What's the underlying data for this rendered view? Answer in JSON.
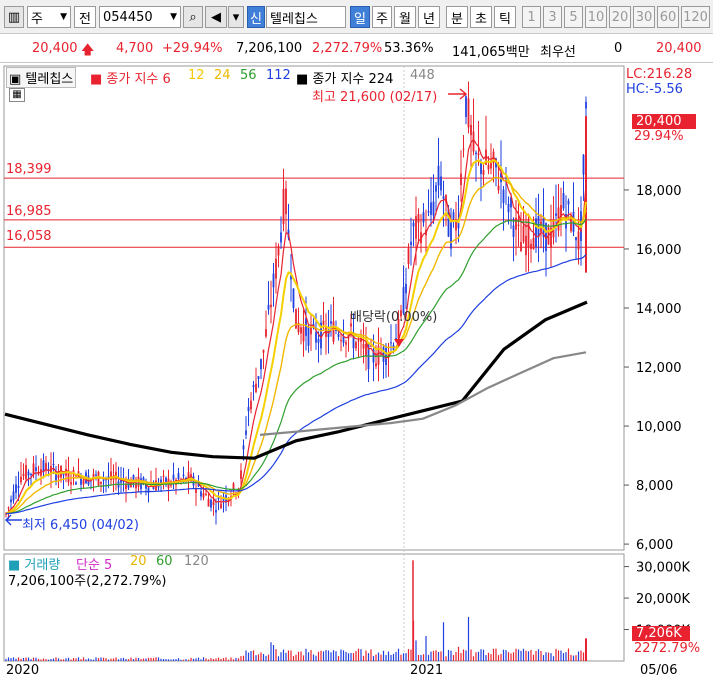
{
  "toolbar": {
    "market": "주",
    "type": "전",
    "code": "054450",
    "name_tag": "신",
    "name": "텔레칩스",
    "periods": [
      "일",
      "주",
      "월",
      "년"
    ],
    "active_period": "일",
    "intraday": [
      "분",
      "초",
      "틱"
    ],
    "minutes": [
      "1",
      "3",
      "5",
      "10",
      "20",
      "30",
      "60",
      "120"
    ]
  },
  "quote": {
    "price": "20,400",
    "change": "4,700",
    "change_pct": "+29.94%",
    "volume": "7,206,100",
    "volume_pct": "2,272.79%",
    "ratio": "53.36%",
    "amount": "141,065백만",
    "priority_label": "최우선",
    "priority_value": "0",
    "priority_price": "20,400"
  },
  "legend": {
    "name": "텔레칩스",
    "ma_label": "종가 지수 6",
    "ma": [
      "12",
      "24",
      "56",
      "112"
    ],
    "ma2_label": "종가 지수 224",
    "ma2_extra": "448"
  },
  "annotations": {
    "high": "최고 21,600 (02/17)",
    "low": "최저 6,450 (04/02)",
    "dividend": "배당락(0.00%)",
    "lc": "LC:216.28",
    "hc": "HC:-5.56",
    "last_price": "20,400",
    "last_pct": "29.94%"
  },
  "levels": [
    {
      "label": "18,399",
      "value": 18399
    },
    {
      "label": "16,985",
      "value": 16985
    },
    {
      "label": "16,058",
      "value": 16058
    }
  ],
  "volume_panel": {
    "title": "거래량",
    "ma_label": "단순 5",
    "ma": [
      "20",
      "60",
      "120"
    ],
    "info": "7,206,100주(2,272.79%)",
    "last_value": "7,206K",
    "last_pct": "2272.79%"
  },
  "x_axis": {
    "labels": [
      "2020",
      "2021",
      "05/06"
    ]
  },
  "colors": {
    "up": "#e8232f",
    "down": "#1f3fe0",
    "ma6": "#e8232f",
    "ma12": "#f5d000",
    "ma24": "#f0b800",
    "ma56": "#2e9e2e",
    "ma112": "#1f3fe0",
    "ma224": "#000000",
    "ma448": "#888888"
  },
  "chart_data": {
    "type": "candlestick",
    "ylim": [
      5800,
      22200
    ],
    "yticks": [
      "6,000",
      "8,000",
      "10,000",
      "12,000",
      "14,000",
      "16,000",
      "18,000"
    ],
    "volume_yticks": [
      "10,000K",
      "20,000K",
      "30,000K"
    ],
    "high": 21600,
    "low": 6450,
    "last": 20400,
    "ma224": [
      10400,
      10050,
      9700,
      9380,
      9110,
      8960,
      8910,
      9500,
      9800,
      10150,
      10500,
      10850,
      12600,
      13600,
      14200
    ],
    "ma448": [
      9700,
      9800,
      9900,
      10000,
      10100,
      10250,
      10700,
      11300,
      11800,
      12300,
      12500
    ]
  }
}
